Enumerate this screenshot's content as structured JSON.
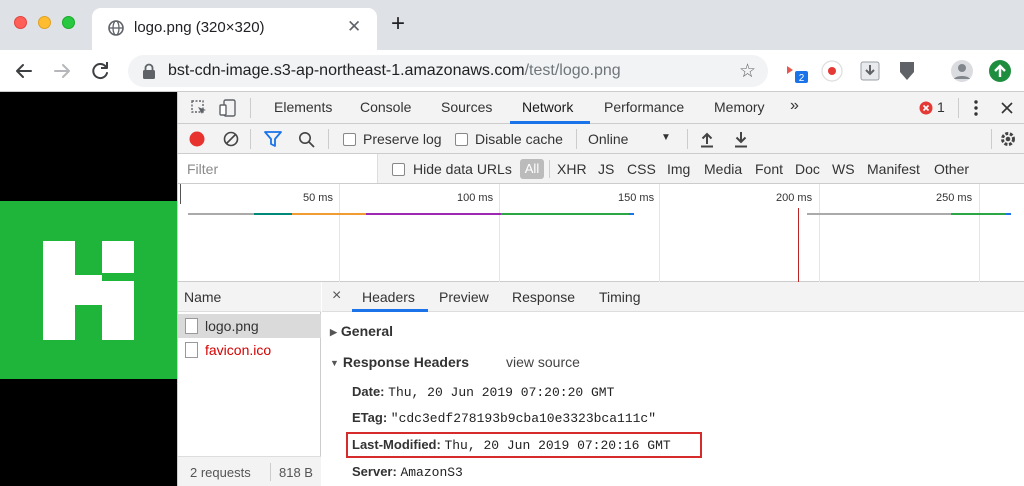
{
  "browser": {
    "tab_title": "logo.png (320×320)",
    "new_tab_label": "+",
    "tab_close_label": "✕",
    "url_host": "bst-cdn-image.s3-ap-northeast-1.amazonaws.com",
    "url_path": "/test/logo.png",
    "extension_badge": "2"
  },
  "devtools": {
    "tabs": [
      "Elements",
      "Console",
      "Sources",
      "Network",
      "Performance",
      "Memory"
    ],
    "active_tab": "Network",
    "more_label": "»",
    "error_count": "1",
    "toolbar": {
      "preserve_log": "Preserve log",
      "disable_cache": "Disable cache",
      "throttle": "Online"
    },
    "filter": {
      "placeholder": "Filter",
      "hide_data_urls": "Hide data URLs",
      "types": [
        "All",
        "XHR",
        "JS",
        "CSS",
        "Img",
        "Media",
        "Font",
        "Doc",
        "WS",
        "Manifest",
        "Other"
      ]
    },
    "overview": {
      "ticks": [
        "50 ms",
        "100 ms",
        "150 ms",
        "200 ms",
        "250 ms"
      ]
    },
    "requests": {
      "header": "Name",
      "items": [
        {
          "name": "logo.png",
          "color": "#333333"
        },
        {
          "name": "favicon.ico",
          "color": "#d50000"
        }
      ],
      "footer_count": "2 requests",
      "footer_size": "818 B"
    },
    "detail": {
      "close_label": "×",
      "tabs": [
        "Headers",
        "Preview",
        "Response",
        "Timing"
      ],
      "active_tab": "Headers",
      "general_label": "General",
      "response_headers_label": "Response Headers",
      "view_source_label": "view source",
      "headers": [
        {
          "key": "Date:",
          "value": "Thu, 20 Jun 2019 07:20:20 GMT"
        },
        {
          "key": "ETag:",
          "value": "\"cdc3edf278193b9cba10e3323bca111c\""
        },
        {
          "key": "Last-Modified:",
          "value": "Thu, 20 Jun 2019 07:20:16 GMT"
        },
        {
          "key": "Server:",
          "value": "AmazonS3"
        }
      ]
    }
  },
  "colors": {
    "accent": "#1a73e8",
    "record": "#e8322e",
    "highlight": "#d62b2b",
    "logo_green": "#1fb43a"
  }
}
